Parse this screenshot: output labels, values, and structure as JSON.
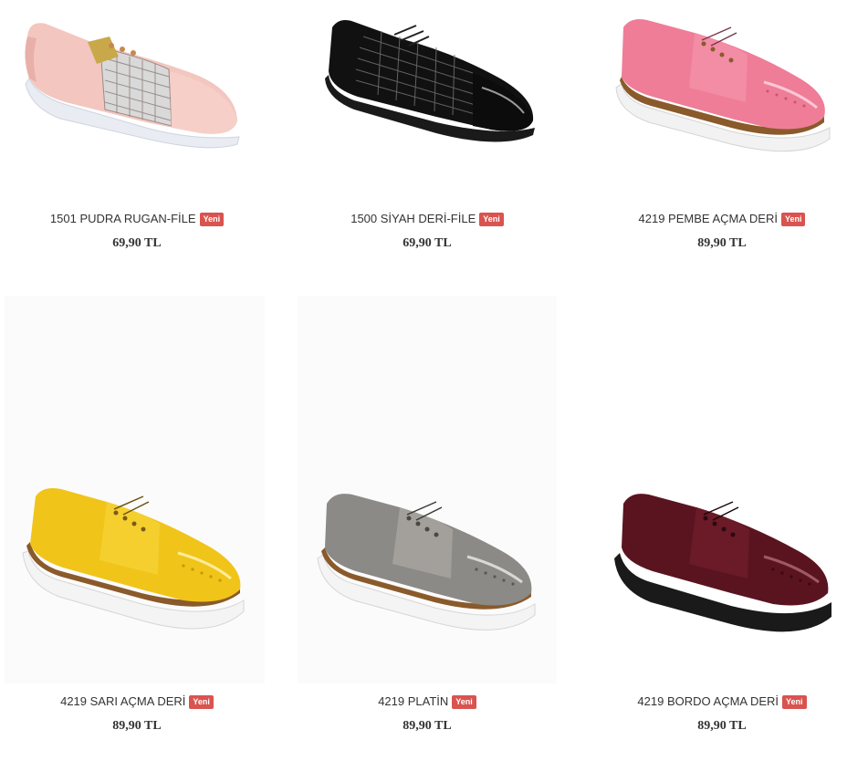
{
  "badge_color": "#d9534f",
  "products": [
    {
      "name": "1501 PUDRA RUGAN-FİLE",
      "badge": "Yeni",
      "price": "69,90 TL",
      "icon": "shoe-pink-mesh-image"
    },
    {
      "name": "1500 SİYAH DERİ-FİLE",
      "badge": "Yeni",
      "price": "69,90 TL",
      "icon": "shoe-black-mesh-image"
    },
    {
      "name": "4219 PEMBE AÇMA DERİ",
      "badge": "Yeni",
      "price": "89,90 TL",
      "icon": "shoe-pink-oxford-image"
    },
    {
      "name": "4219 SARI AÇMA DERİ",
      "badge": "Yeni",
      "price": "89,90 TL",
      "icon": "shoe-yellow-oxford-image"
    },
    {
      "name": "4219 PLATİN",
      "badge": "Yeni",
      "price": "89,90 TL",
      "icon": "shoe-platinum-oxford-image"
    },
    {
      "name": "4219 BORDO AÇMA DERİ",
      "badge": "Yeni",
      "price": "89,90 TL",
      "icon": "shoe-burgundy-oxford-image"
    }
  ]
}
